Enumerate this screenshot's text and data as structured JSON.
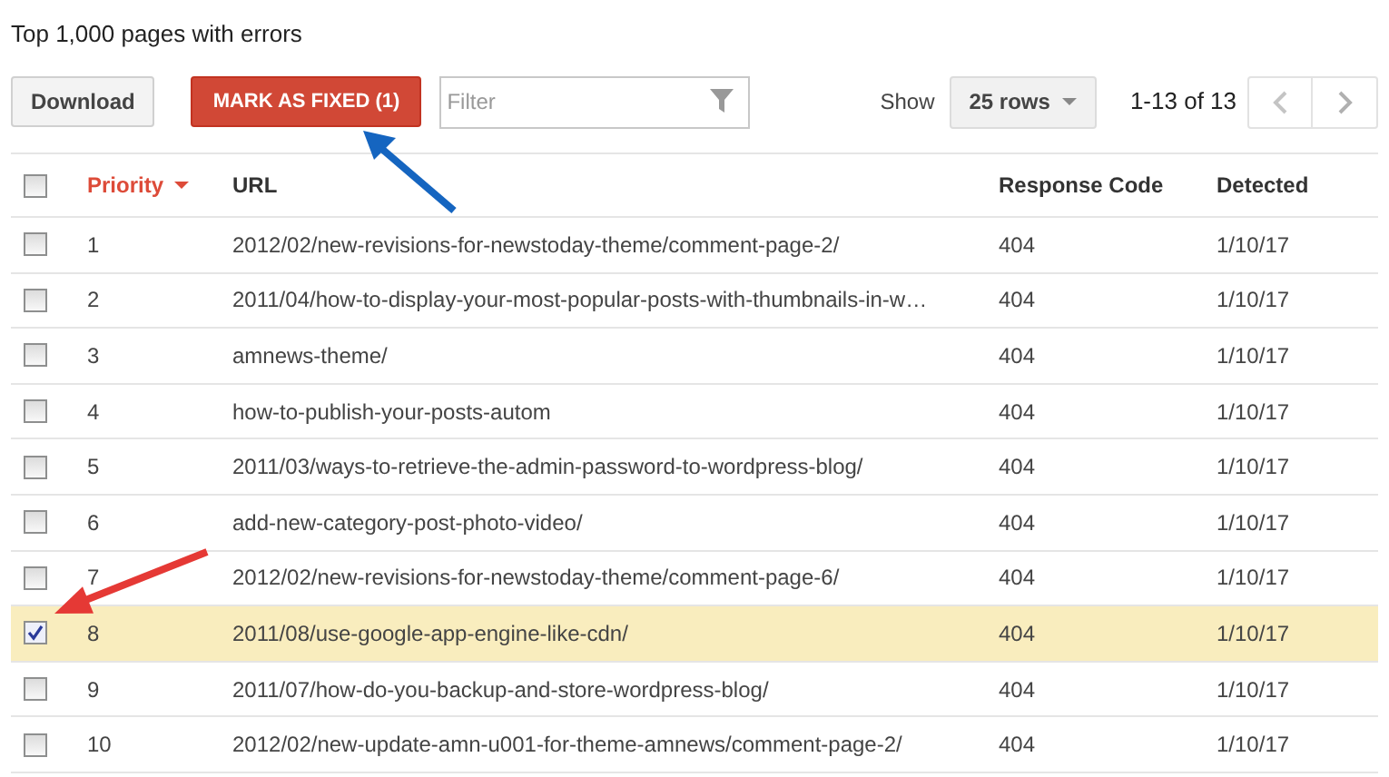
{
  "title": "Top 1,000 pages with errors",
  "toolbar": {
    "download": "Download",
    "mark_fixed": "MARK AS FIXED (1)",
    "filter": {
      "placeholder": "Filter"
    },
    "show_label": "Show",
    "rows_select": "25 rows",
    "range": "1-13 of 13"
  },
  "table": {
    "select_all": {
      "checked": false
    },
    "columns": [
      {
        "label": "Priority",
        "sorted": true
      },
      {
        "label": "URL",
        "sorted": false
      },
      {
        "label": "Response Code",
        "sorted": false
      },
      {
        "label": "Detected",
        "sorted": false
      }
    ],
    "rows": [
      {
        "checked": false,
        "priority": "1",
        "url": "2012/02/new-revisions-for-newstoday-theme/comment-page-2/",
        "code": "404",
        "detected": "1/10/17"
      },
      {
        "checked": false,
        "priority": "2",
        "url": "2011/04/how-to-display-your-most-popular-posts-with-thumbnails-in-w…",
        "code": "404",
        "detected": "1/10/17"
      },
      {
        "checked": false,
        "priority": "3",
        "url": "amnews-theme/",
        "code": "404",
        "detected": "1/10/17"
      },
      {
        "checked": false,
        "priority": "4",
        "url": "how-to-publish-your-posts-autom",
        "code": "404",
        "detected": "1/10/17"
      },
      {
        "checked": false,
        "priority": "5",
        "url": "2011/03/ways-to-retrieve-the-admin-password-to-wordpress-blog/",
        "code": "404",
        "detected": "1/10/17"
      },
      {
        "checked": false,
        "priority": "6",
        "url": "add-new-category-post-photo-video/",
        "code": "404",
        "detected": "1/10/17"
      },
      {
        "checked": false,
        "priority": "7",
        "url": "2012/02/new-revisions-for-newstoday-theme/comment-page-6/",
        "code": "404",
        "detected": "1/10/17"
      },
      {
        "checked": true,
        "priority": "8",
        "url": "2011/08/use-google-app-engine-like-cdn/",
        "code": "404",
        "detected": "1/10/17"
      },
      {
        "checked": false,
        "priority": "9",
        "url": "2011/07/how-do-you-backup-and-store-wordpress-blog/",
        "code": "404",
        "detected": "1/10/17"
      },
      {
        "checked": false,
        "priority": "10",
        "url": "2012/02/new-update-amn-u001-for-theme-amnews/comment-page-2/",
        "code": "404",
        "detected": "1/10/17"
      }
    ]
  }
}
